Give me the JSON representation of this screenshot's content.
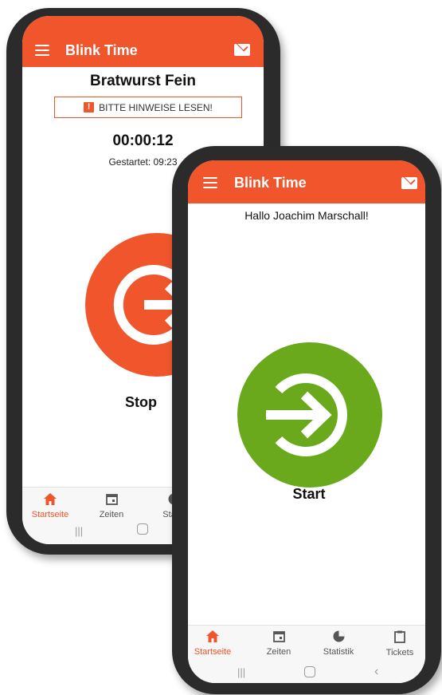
{
  "back_phone": {
    "app_title": "Blink Time",
    "product": "Bratwurst Fein",
    "notice_button": "BITTE HINWEISE LESEN!",
    "timer": "00:00:12",
    "started": "Gestartet: 09:23",
    "action_label": "Stop",
    "nav": [
      "Startseite",
      "Zeiten",
      "Statis"
    ],
    "accent_color": "#f0552c"
  },
  "front_phone": {
    "app_title": "Blink Time",
    "greeting": "Hallo Joachim Marschall!",
    "action_label": "Start",
    "nav": [
      "Startseite",
      "Zeiten",
      "Statistik",
      "Tickets"
    ],
    "accent_color": "#f0552c",
    "start_color": "#6aa81c"
  },
  "icons": {
    "menu": "hamburger-icon",
    "mail": "mail-icon",
    "home": "home-icon",
    "calendar": "calendar-icon",
    "stats": "pie-chart-icon",
    "tickets": "clipboard-icon",
    "enter": "enter-circle-arrow-icon"
  }
}
